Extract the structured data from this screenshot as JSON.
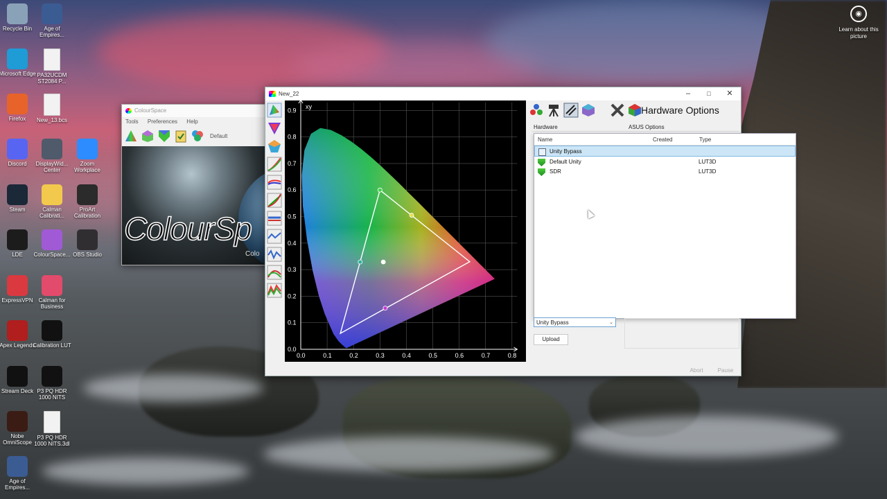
{
  "desktop": {
    "icons": [
      {
        "label": "Recycle Bin",
        "icon": "recycle-bin-icon",
        "color": "#8aa2b8"
      },
      {
        "label": "Age of Empires...",
        "icon": "age-of-empires-icon",
        "color": "#3b5b93"
      },
      {
        "label": "Microsoft Edge",
        "icon": "edge-icon",
        "color": "#1f9bd6"
      },
      {
        "label": "PA32UCDM ST2084 P...",
        "icon": "document-icon",
        "color": "#f2f2f2"
      },
      {
        "label": "Firefox",
        "icon": "firefox-icon",
        "color": "#e8632a"
      },
      {
        "label": "New_13.bcs",
        "icon": "document-icon",
        "color": "#f2f2f2"
      },
      {
        "label": "Discord",
        "icon": "discord-icon",
        "color": "#5865f2"
      },
      {
        "label": "DisplayWid... Center",
        "icon": "displaywidget-icon",
        "color": "#4f5a6b"
      },
      {
        "label": "Zoom Workplace",
        "icon": "zoom-icon",
        "color": "#2d8cff"
      },
      {
        "label": "Steam",
        "icon": "steam-icon",
        "color": "#1b2838"
      },
      {
        "label": "Calman Calibrati...",
        "icon": "folder-icon",
        "color": "#f2c94c"
      },
      {
        "label": "ProArt Calibration",
        "icon": "proart-icon",
        "color": "#2b2b2b"
      },
      {
        "label": "LDE",
        "icon": "lde-icon",
        "color": "#1c1c1c"
      },
      {
        "label": "ColourSpace...",
        "icon": "colourspace-icon",
        "color": "#a05ad6"
      },
      {
        "label": "OBS Studio",
        "icon": "obs-icon",
        "color": "#302e31"
      },
      {
        "label": "ExpressVPN",
        "icon": "expressvpn-icon",
        "color": "#da3940"
      },
      {
        "label": "Calman for Business",
        "icon": "calman-icon",
        "color": "#e24b6b"
      },
      {
        "label": "Apex Legends",
        "icon": "apex-icon",
        "color": "#b01e1e"
      },
      {
        "label": "Calibration LUT",
        "icon": "lut-icon",
        "color": "#111111"
      },
      {
        "label": "Stream Deck",
        "icon": "stream-deck-icon",
        "color": "#111111"
      },
      {
        "label": "P3 PQ HDR 1000 NITS",
        "icon": "lut-icon",
        "color": "#111111"
      },
      {
        "label": "Nobe OmniScope",
        "icon": "omniscope-icon",
        "color": "#3a1c14"
      },
      {
        "label": "P3 PQ HDR 1000 NITS.3dl",
        "icon": "document-icon",
        "color": "#f2f2f2"
      },
      {
        "label": "Age of Empires...",
        "icon": "age-of-empires-icon",
        "color": "#3b5b93"
      }
    ],
    "learn_about": "Learn about this picture"
  },
  "colourspace_window": {
    "title": "ColourSpace",
    "menu": [
      "Tools",
      "Preferences",
      "Help"
    ],
    "profile": "Default",
    "splash_logo": "ColourSp",
    "splash_sub": "Colo"
  },
  "main_window": {
    "title": "New_22",
    "plot": {
      "label": "xy",
      "x_ticks": [
        "0.0",
        "0.1",
        "0.2",
        "0.3",
        "0.4",
        "0.5",
        "0.6",
        "0.7",
        "0.8"
      ],
      "y_ticks": [
        "0.0",
        "0.1",
        "0.2",
        "0.3",
        "0.4",
        "0.5",
        "0.6",
        "0.7",
        "0.8",
        "0.9"
      ]
    },
    "hardware": {
      "title": "Hardware Options",
      "tab_hardware": "Hardware",
      "tab_asus": "ASUS Options",
      "columns": [
        "Name",
        "Created",
        "Type"
      ],
      "rows": [
        {
          "name": "Unity Bypass",
          "created": "",
          "type": "",
          "selected": true
        },
        {
          "name": "Default Unity",
          "created": "",
          "type": "LUT3D",
          "selected": false
        },
        {
          "name": "SDR",
          "created": "",
          "type": "LUT3D",
          "selected": false
        }
      ],
      "dropdown_value": "Unity Bypass",
      "upload_label": "Upload",
      "abort_label": "Abort",
      "pause_label": "Pause"
    }
  }
}
